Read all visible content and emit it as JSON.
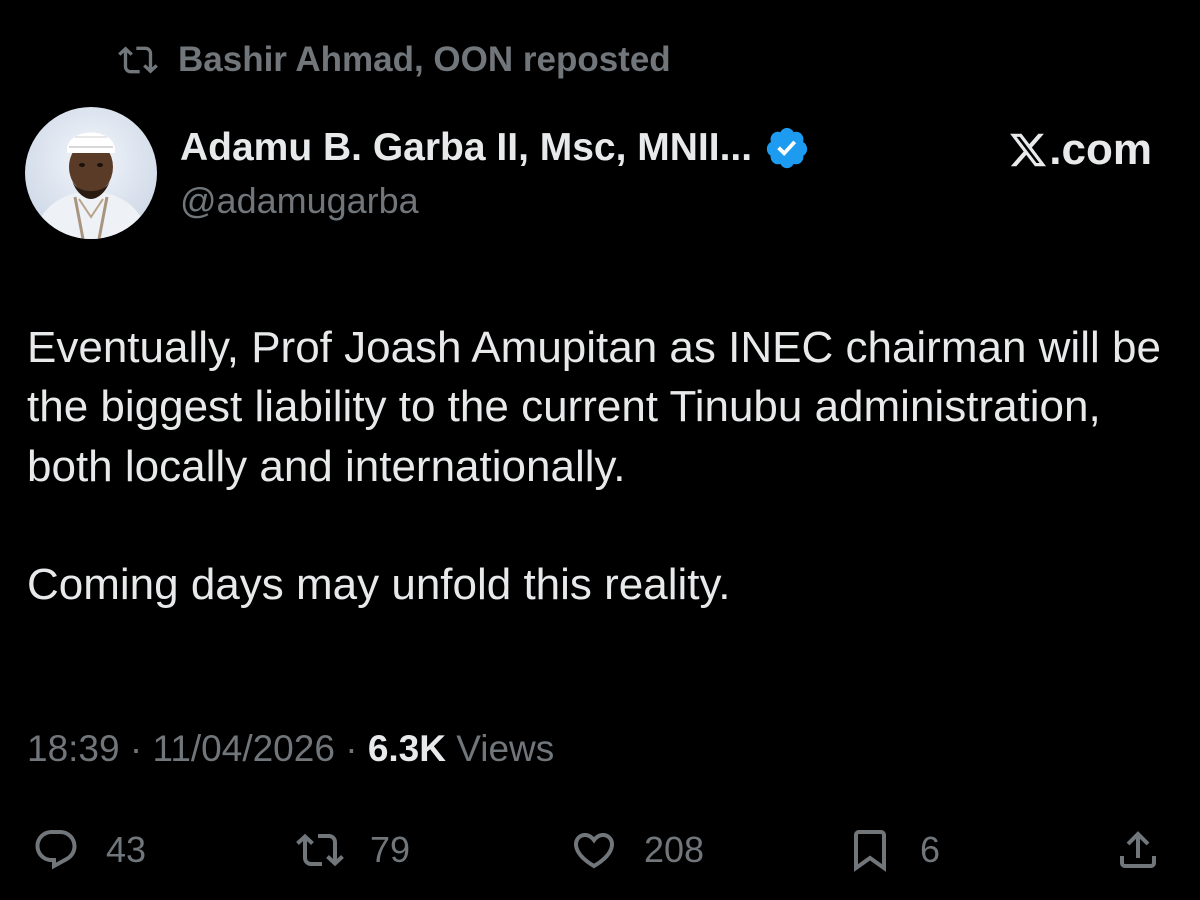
{
  "repost": {
    "label": "Bashir Ahmad, OON reposted",
    "icon": "repost-icon"
  },
  "author": {
    "name": "Adamu B. Garba II, Msc, MNII...",
    "handle": "@adamugarba",
    "verified": true,
    "verified_color": "#1d9bf0",
    "avatar_icon": "avatar"
  },
  "brand": {
    "text": ".com",
    "logo_icon": "x-logo-icon"
  },
  "tweet": {
    "paragraphs": [
      "Eventually, Prof Joash Amupitan as INEC chairman will be the biggest liability to the current Tinubu administration, both locally and internationally.",
      "Coming days may unfold this reality."
    ]
  },
  "meta": {
    "time": "18:39",
    "separator": "·",
    "date": "11/04/2026",
    "views_count": "6.3K",
    "views_label": "Views"
  },
  "actions": {
    "replies": "43",
    "reposts": "79",
    "likes": "208",
    "bookmarks": "6",
    "icons": [
      "reply-icon",
      "repost-icon",
      "like-icon",
      "bookmark-icon",
      "share-icon"
    ]
  },
  "colors": {
    "background": "#000000",
    "text_primary": "#e7e9ea",
    "text_secondary": "#71767b",
    "accent": "#1d9bf0"
  }
}
